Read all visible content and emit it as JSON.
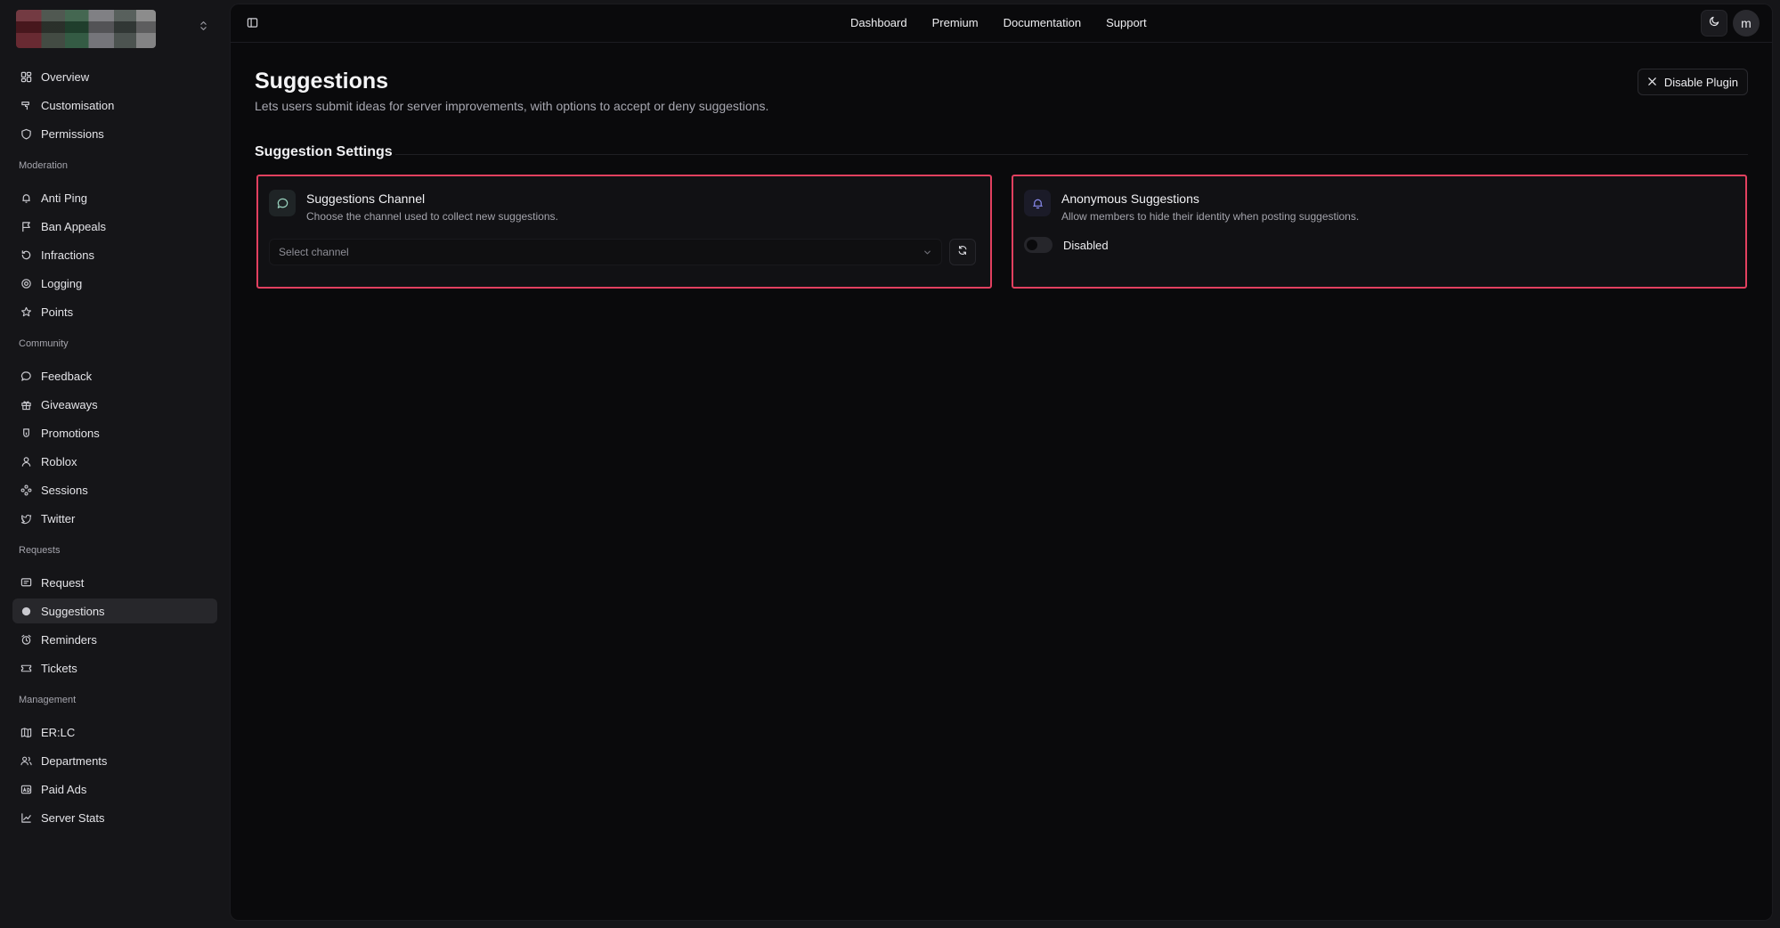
{
  "sidebar": {
    "general": [
      {
        "label": "Overview",
        "icon": "dashboard-icon"
      },
      {
        "label": "Customisation",
        "icon": "brush-icon"
      },
      {
        "label": "Permissions",
        "icon": "shield-icon"
      }
    ],
    "sections": [
      {
        "title": "Moderation",
        "items": [
          {
            "label": "Anti Ping",
            "icon": "bell-icon"
          },
          {
            "label": "Ban Appeals",
            "icon": "flag-icon"
          },
          {
            "label": "Infractions",
            "icon": "history-icon"
          },
          {
            "label": "Logging",
            "icon": "target-icon"
          },
          {
            "label": "Points",
            "icon": "star-icon"
          }
        ]
      },
      {
        "title": "Community",
        "items": [
          {
            "label": "Feedback",
            "icon": "chat-bubble-icon"
          },
          {
            "label": "Giveaways",
            "icon": "gift-icon"
          },
          {
            "label": "Promotions",
            "icon": "badge-icon"
          },
          {
            "label": "Roblox",
            "icon": "user-icon"
          },
          {
            "label": "Sessions",
            "icon": "network-icon"
          },
          {
            "label": "Twitter",
            "icon": "twitter-icon"
          }
        ]
      },
      {
        "title": "Requests",
        "items": [
          {
            "label": "Request",
            "icon": "message-square-icon"
          },
          {
            "label": "Suggestions",
            "icon": "dot-icon",
            "active": true
          },
          {
            "label": "Reminders",
            "icon": "alarm-icon"
          },
          {
            "label": "Tickets",
            "icon": "ticket-icon"
          }
        ]
      },
      {
        "title": "Management",
        "items": [
          {
            "label": "ER:LC",
            "icon": "map-icon"
          },
          {
            "label": "Departments",
            "icon": "users-icon"
          },
          {
            "label": "Paid Ads",
            "icon": "ad-icon"
          },
          {
            "label": "Server Stats",
            "icon": "chart-icon"
          }
        ]
      }
    ]
  },
  "topnav": {
    "links": [
      "Dashboard",
      "Premium",
      "Documentation",
      "Support"
    ],
    "avatar_letter": "m"
  },
  "page": {
    "title": "Suggestions",
    "description": "Lets users submit ideas for server improvements, with options to accept or deny suggestions.",
    "disable_label": "Disable Plugin",
    "section_title": "Suggestion Settings"
  },
  "cards": {
    "channel": {
      "title": "Suggestions Channel",
      "subtitle": "Choose the channel used to collect new suggestions.",
      "select_placeholder": "Select channel"
    },
    "anonymous": {
      "title": "Anonymous Suggestions",
      "subtitle": "Allow members to hide their identity when posting suggestions.",
      "toggle_label": "Disabled",
      "enabled": false
    }
  },
  "colors": {
    "accent_border": "#e2405f",
    "background": "#0a0a0c",
    "sidebar": "#151518"
  }
}
